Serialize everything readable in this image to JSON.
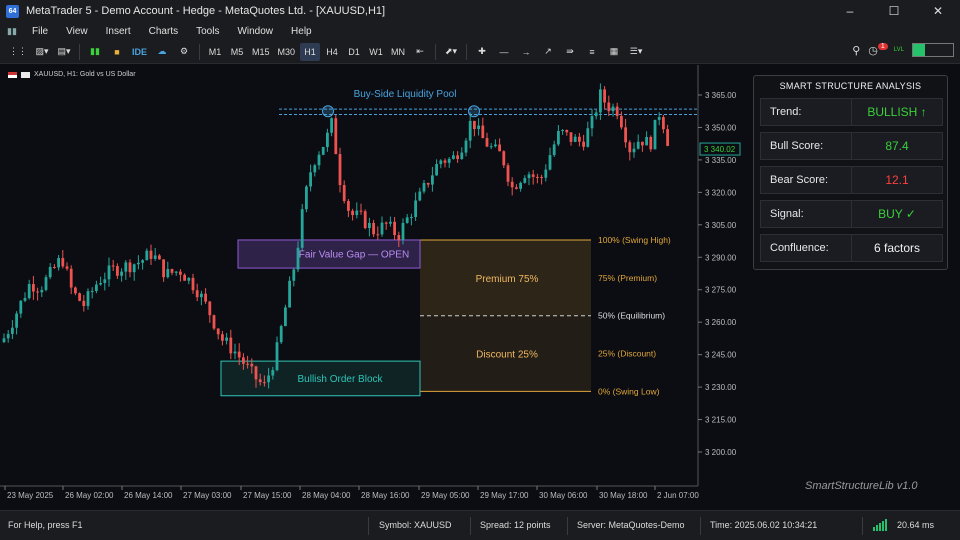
{
  "window": {
    "title": "MetaTrader 5 - Demo Account - Hedge - MetaQuotes Ltd. - [XAUUSD,H1]",
    "app_icon": "64",
    "controls": [
      "minimize-icon",
      "maximize-icon",
      "close-icon"
    ]
  },
  "menu": [
    "File",
    "View",
    "Insert",
    "Charts",
    "Tools",
    "Window",
    "Help"
  ],
  "toolbar": {
    "buttons": [
      "IDE"
    ],
    "timeframes": [
      "M1",
      "M5",
      "M15",
      "M30",
      "H1",
      "H4",
      "D1",
      "W1",
      "MN"
    ],
    "active_timeframe": "H1",
    "notification_count": "1",
    "level_label": "LVL"
  },
  "chart": {
    "symbol_header": "XAUUSD, H1:  Gold vs US Dollar",
    "current_price": "3 340.02",
    "price_axis": [
      "3 365.00",
      "3 350.00",
      "3 335.00",
      "3 320.00",
      "3 305.00",
      "3 290.00",
      "3 275.00",
      "3 260.00",
      "3 245.00",
      "3 230.00",
      "3 215.00",
      "3 200.00"
    ],
    "time_axis": [
      "23 May 2025",
      "26 May 02:00",
      "26 May 14:00",
      "27 May 03:00",
      "27 May 15:00",
      "28 May 04:00",
      "28 May 16:00",
      "29 May 05:00",
      "29 May 17:00",
      "30 May 06:00",
      "30 May 18:00",
      "2 Jun 07:00"
    ],
    "annotations": {
      "liquidity_pool": "Buy-Side Liquidity Pool",
      "fvg": "Fair Value Gap — OPEN",
      "order_block": "Bullish Order Block",
      "premium_zone": "Premium 75%",
      "discount_zone": "Discount 25%",
      "fib_100": "100% (Swing High)",
      "fib_75": "75% (Premium)",
      "fib_50": "50% (Equilibrium)",
      "fib_25": "25% (Discount)",
      "fib_0": "0% (Swing Low)"
    },
    "colors": {
      "bull": "#26a69a",
      "bear": "#ef5350",
      "fvg": "#8e5bd6",
      "order_block": "#2ec4b6",
      "fib": "#e0a63a",
      "liquidity": "#4aa3df"
    },
    "watermark": "SmartStructureLib v1.0"
  },
  "panel": {
    "title": "SMART STRUCTURE ANALYSIS",
    "rows": [
      {
        "label": "Trend:",
        "value": "BULLISH ↑",
        "color": "#3ad13a"
      },
      {
        "label": "Bull Score:",
        "value": "87.4",
        "color": "#3ad13a"
      },
      {
        "label": "Bear Score:",
        "value": "12.1",
        "color": "#ff4040"
      },
      {
        "label": "Signal:",
        "value": "BUY ✓",
        "color": "#3ad13a"
      },
      {
        "label": "Confluence:",
        "value": "6 factors",
        "color": "#f0f0f0"
      }
    ]
  },
  "status": {
    "help": "For Help, press F1",
    "symbol": "Symbol:  XAUUSD",
    "spread": "Spread:  12 points",
    "server": "Server:  MetaQuotes-Demo",
    "time": "Time:  2025.06.02 10:34:21",
    "ping": "20.64 ms"
  }
}
